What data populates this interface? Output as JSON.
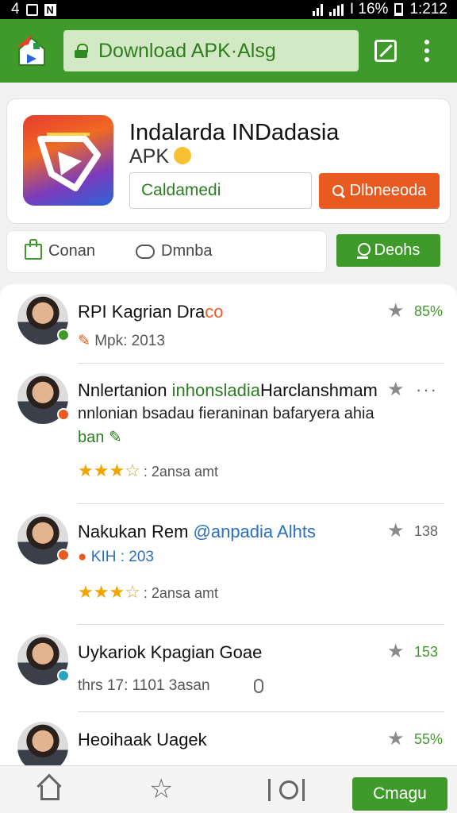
{
  "status_bar": {
    "left_text": "4",
    "battery_text": "I 16%",
    "time": "1:212"
  },
  "toolbar": {
    "url_text": "Download  APK·Alsg"
  },
  "app": {
    "title": "Indalarda INDadasia",
    "subtitle": "APK",
    "version_field": "Caldamedi",
    "download_label": "Dlbneeoda"
  },
  "actions": {
    "share_label": "Conan",
    "report_label": "Dmnba",
    "follow_label": "Deohs"
  },
  "reviews": [
    {
      "name": "RPI Kagrian  Dra",
      "name_suffix": "co",
      "meta": "Mpk:  2013",
      "score": "85%"
    },
    {
      "name_a": "Nnlertanion ",
      "name_hl": "inhonsladia",
      "name_b": "Harclanshmam",
      "line2": "nnlonian bsadau fieraninan bafaryera ahia",
      "line3_hl": "ban",
      "stars": "★★★",
      "stars_empty": "☆",
      "stars_caption": ": 2ansa amt",
      "more": "···"
    },
    {
      "name_a": "Nakukan Rem ",
      "name_hl": "@anpadia Alhts",
      "meta": "KIH :  203",
      "score": "138",
      "stars": "★★★",
      "stars_empty": "☆",
      "stars_caption": ": 2ansa amt"
    },
    {
      "name": "Uykariok Kpagian Goae",
      "meta": "thrs 17: 1101 3asan",
      "score": "153"
    },
    {
      "name": "Heoihaak Uagek",
      "score": "55%"
    }
  ],
  "bottom_nav": {
    "cta_label": "Cmagu"
  },
  "colors": {
    "brand_green": "#3f9a2b",
    "download_orange": "#e85a1f",
    "star_gold": "#f0a500"
  },
  "icons": [
    "app-logo-icon",
    "lock-icon",
    "edit-square-icon",
    "overflow-menu-icon",
    "search-icon",
    "like-icon",
    "chat-icon",
    "pin-icon",
    "star-icon",
    "home-icon",
    "camera-icon",
    "mic-icon"
  ]
}
